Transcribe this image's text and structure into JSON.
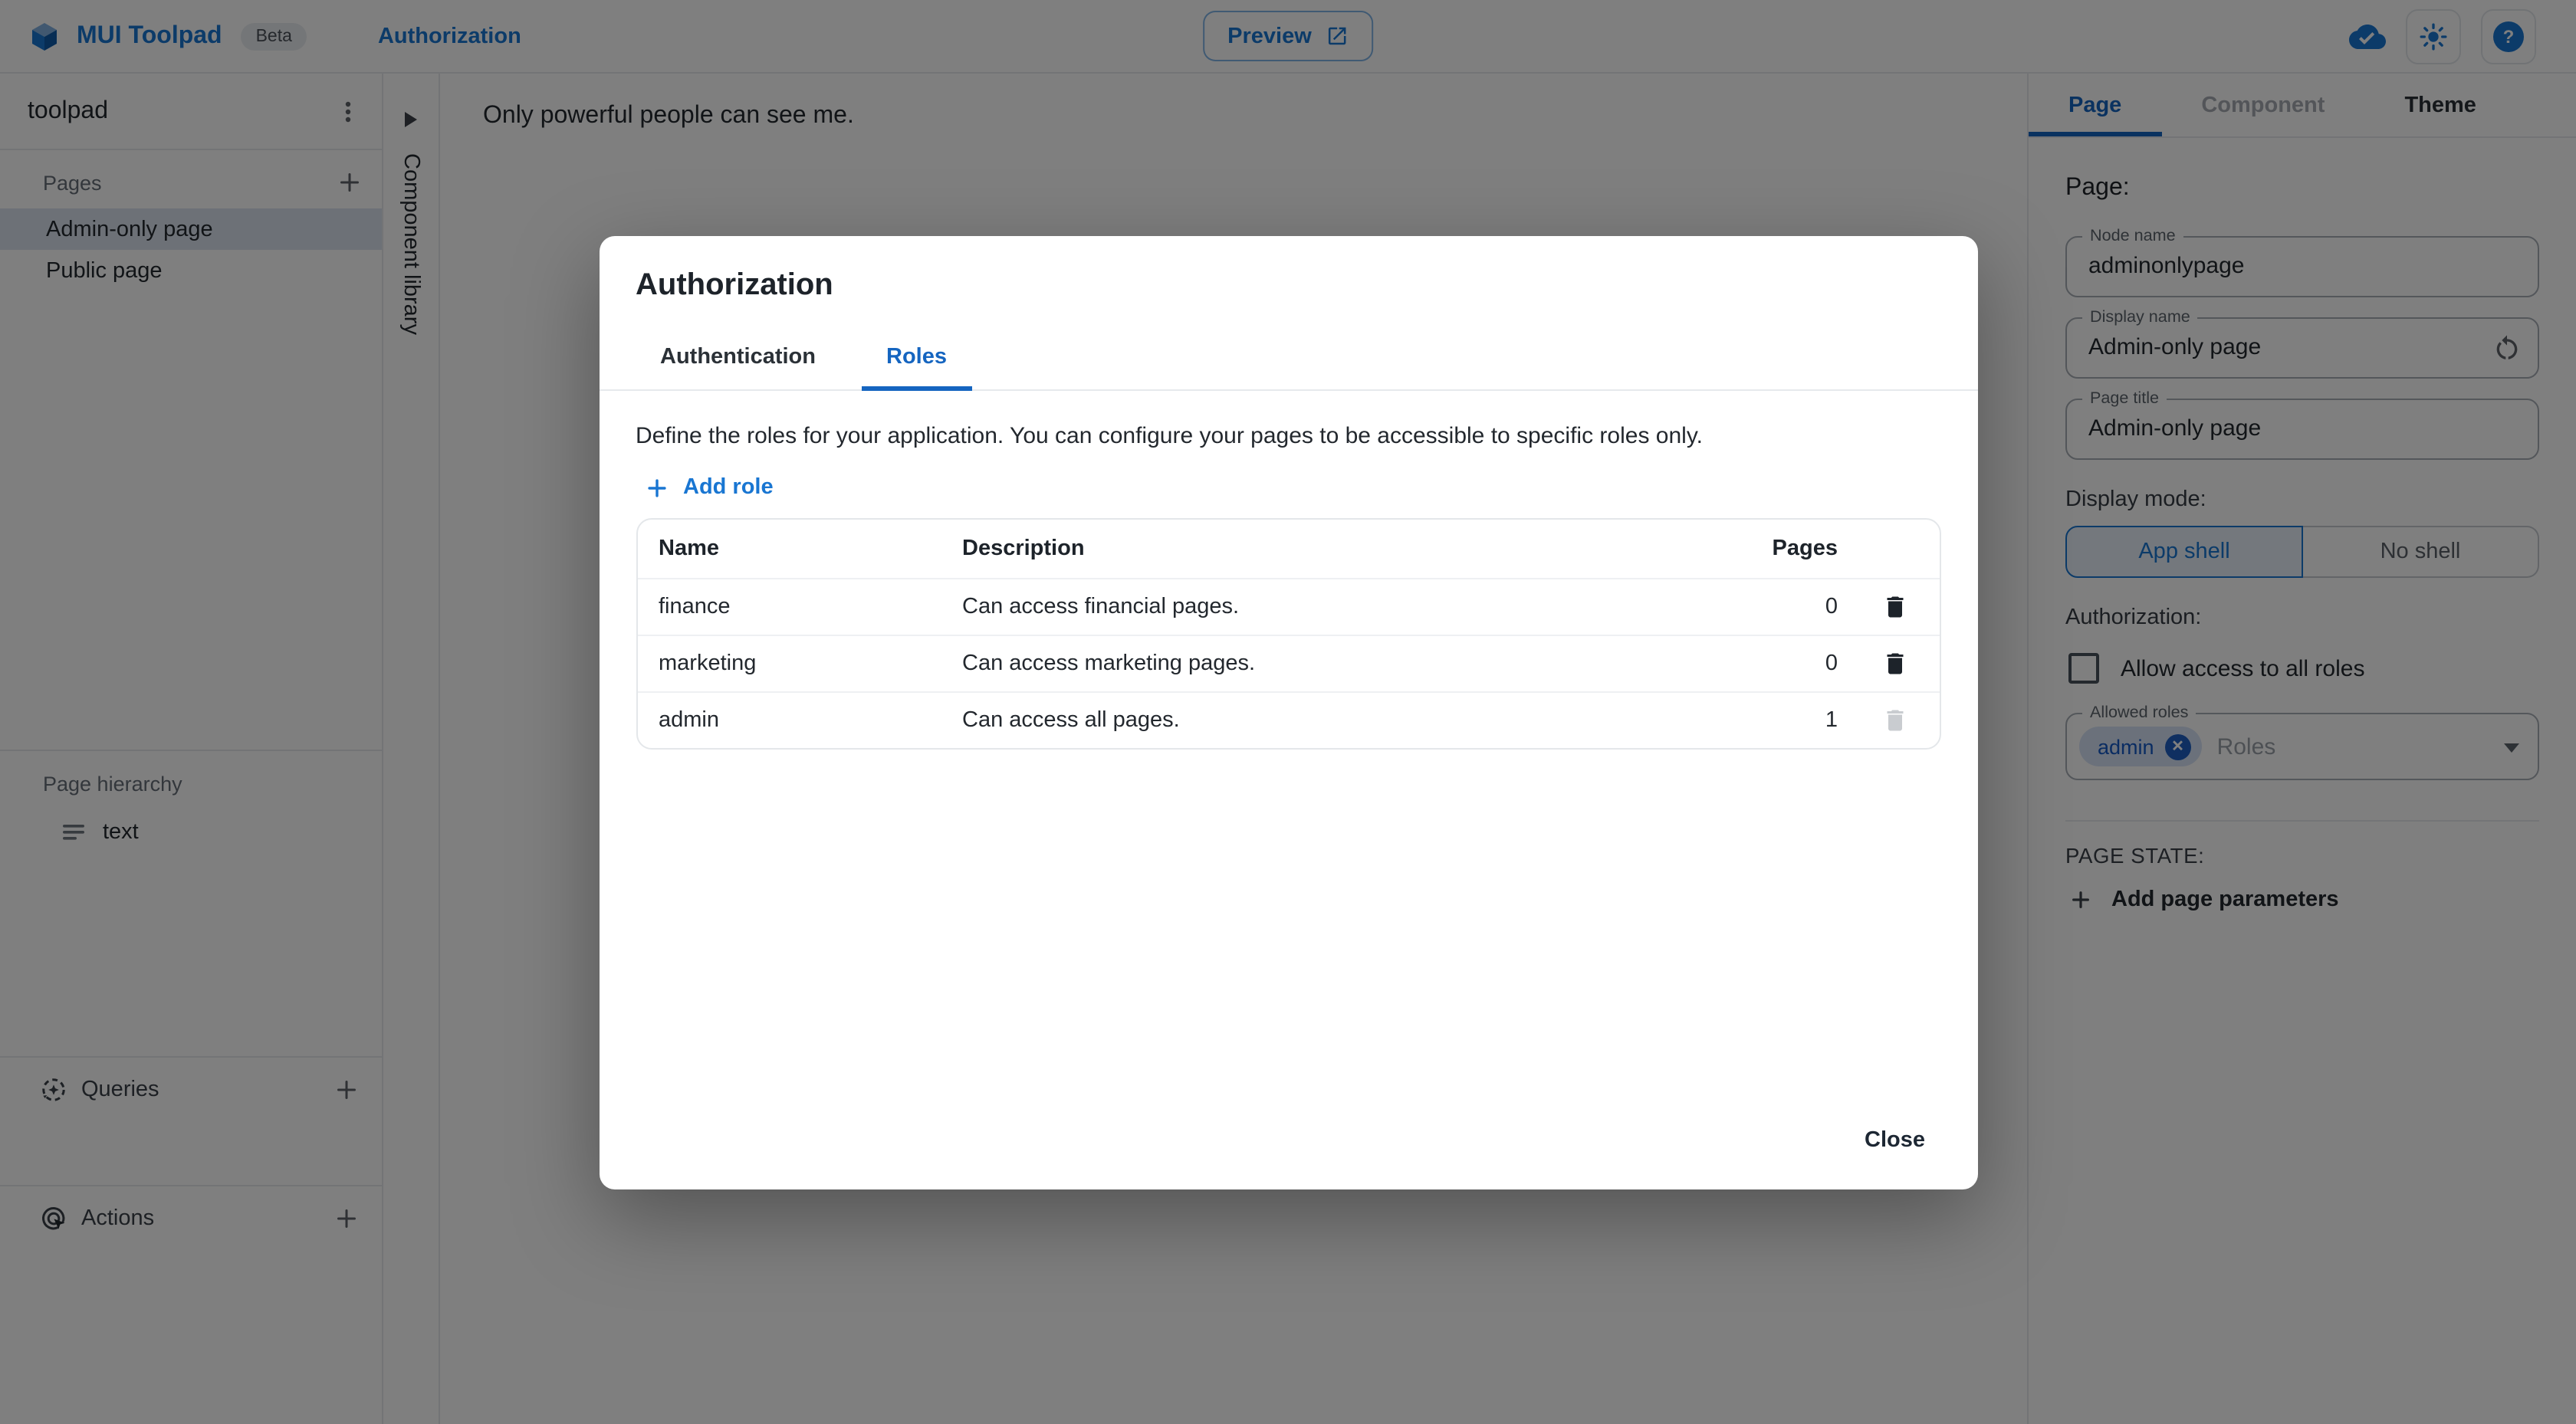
{
  "header": {
    "app_name": "MUI Toolpad",
    "beta_badge": "Beta",
    "nav_current": "Authorization",
    "preview_button": "Preview"
  },
  "sidebar": {
    "project_name": "toolpad",
    "pages_section_label": "Pages",
    "pages": [
      {
        "label": "Admin-only page",
        "selected": true
      },
      {
        "label": "Public page",
        "selected": false
      }
    ],
    "hierarchy_label": "Page hierarchy",
    "hierarchy_items": [
      {
        "label": "text",
        "icon": "text-component-icon"
      }
    ],
    "queries_label": "Queries",
    "actions_label": "Actions"
  },
  "component_library": {
    "label": "Component library"
  },
  "canvas": {
    "content_text": "Only powerful people can see me."
  },
  "dialog": {
    "title": "Authorization",
    "tabs": [
      {
        "label": "Authentication",
        "active": false
      },
      {
        "label": "Roles",
        "active": true
      }
    ],
    "description": "Define the roles for your application. You can configure your pages to be accessible to specific roles only.",
    "add_role_button": "Add role",
    "table": {
      "headers": [
        "Name",
        "Description",
        "Pages"
      ],
      "rows": [
        {
          "name": "finance",
          "description": "Can access financial pages.",
          "pages": "0",
          "deletable": true
        },
        {
          "name": "marketing",
          "description": "Can access marketing pages.",
          "pages": "0",
          "deletable": true
        },
        {
          "name": "admin",
          "description": "Can access all pages.",
          "pages": "1",
          "deletable": false
        }
      ]
    },
    "close_button": "Close"
  },
  "inspector": {
    "tabs": [
      {
        "label": "Page",
        "state": "active"
      },
      {
        "label": "Component",
        "state": "disabled"
      },
      {
        "label": "Theme",
        "state": "normal"
      }
    ],
    "heading": "Page:",
    "fields": [
      {
        "label": "Node name",
        "value": "adminonlypage"
      },
      {
        "label": "Display name",
        "value": "Admin-only page",
        "has_reset": true
      },
      {
        "label": "Page title",
        "value": "Admin-only page"
      }
    ],
    "display_mode_label": "Display mode:",
    "display_mode_options": [
      {
        "label": "App shell",
        "selected": true
      },
      {
        "label": "No shell",
        "selected": false
      }
    ],
    "authorization_label": "Authorization:",
    "allow_all_roles_label": "Allow access to all roles",
    "allow_all_roles_checked": false,
    "allowed_roles": {
      "label": "Allowed roles",
      "chips": [
        "admin"
      ],
      "placeholder": "Roles"
    },
    "page_state_label": "PAGE STATE:",
    "add_page_parameters_button": "Add page parameters"
  },
  "icons": [
    "mui-logo-icon",
    "cloud-done-icon",
    "theme-brightness-icon",
    "help-icon",
    "open-in-new-icon",
    "kebab-menu-icon",
    "plus-icon",
    "collapse-arrow-icon",
    "text-component-icon",
    "queries-icon",
    "actions-click-icon",
    "trash-icon",
    "reset-icon",
    "chip-delete-icon",
    "caret-down-icon",
    "checkbox-unchecked"
  ],
  "colors": {
    "primary": "#1976d2",
    "active_tab": "#1565c0",
    "text_primary": "#23282e",
    "border": "#e6e9ec",
    "selected_item_bg": "#dbe3ee",
    "chip_bg": "#d7e3f7",
    "chip_text": "#1459c4",
    "disabled_icon": "#c9ccd0",
    "backdrop": "rgba(0,0,0,0.5)"
  }
}
